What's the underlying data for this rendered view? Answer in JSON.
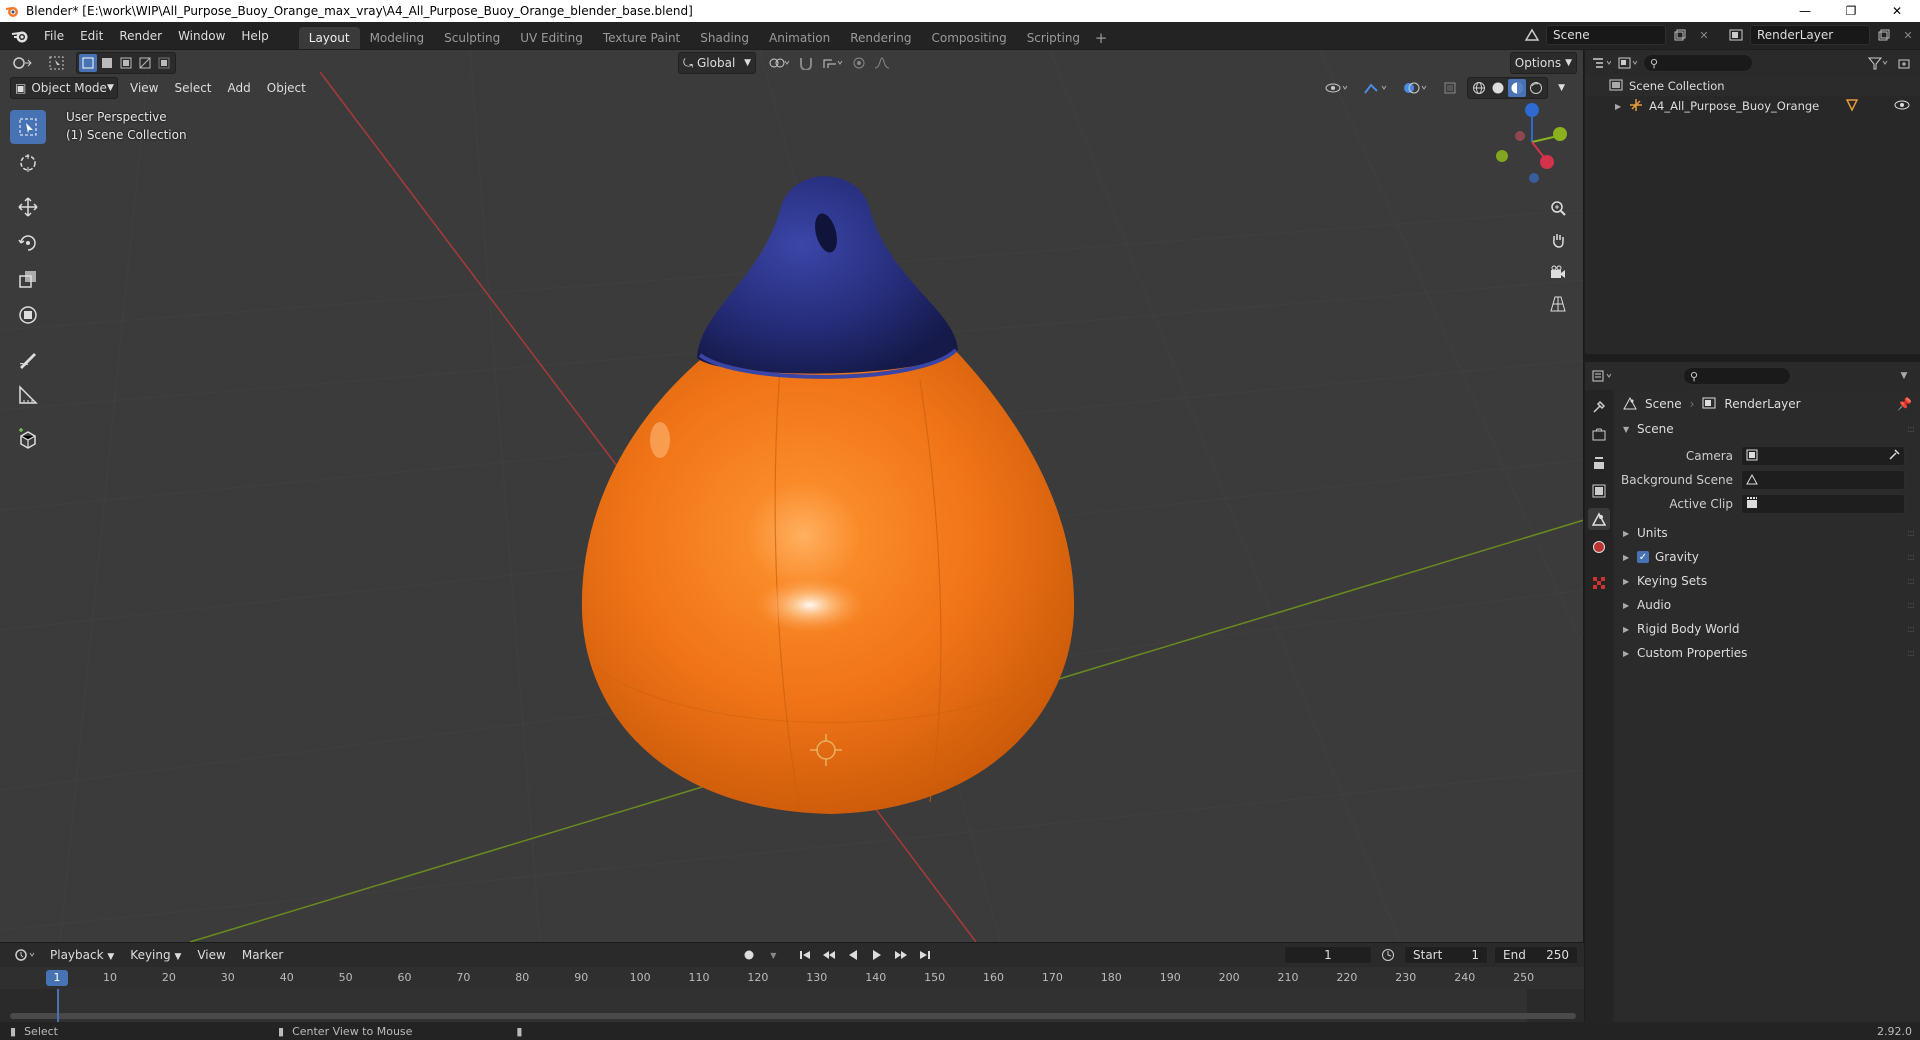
{
  "window": {
    "title": "Blender* [E:\\work\\WIP\\All_Purpose_Buoy_Orange_max_vray\\A4_All_Purpose_Buoy_Orange_blender_base.blend]"
  },
  "menu": {
    "items": [
      "File",
      "Edit",
      "Render",
      "Window",
      "Help"
    ]
  },
  "workspaces": {
    "tabs": [
      "Layout",
      "Modeling",
      "Sculpting",
      "UV Editing",
      "Texture Paint",
      "Shading",
      "Animation",
      "Rendering",
      "Compositing",
      "Scripting"
    ],
    "active": "Layout"
  },
  "topright": {
    "scene": "Scene",
    "view_layer": "RenderLayer"
  },
  "viewport": {
    "mode": "Object Mode",
    "menus": [
      "View",
      "Select",
      "Add",
      "Object"
    ],
    "transform_orientation": "Global",
    "options_label": "Options",
    "overlay_line1": "User Perspective",
    "overlay_line2": "(1) Scene Collection",
    "gizmo_axes": [
      "X",
      "Y",
      "Z"
    ],
    "colors": {
      "buoy_body": "#f07417",
      "buoy_cap": "#252c78",
      "bg": "#3b3b3b",
      "x_axis": "#a83a3a",
      "y_axis": "#6a8b1e"
    }
  },
  "outliner": {
    "root": "Scene Collection",
    "items": [
      "A4_All_Purpose_Buoy_Orange"
    ]
  },
  "properties": {
    "breadcrumb": [
      "Scene",
      "RenderLayer"
    ],
    "panel_title": "Scene",
    "fields": [
      {
        "label": "Camera"
      },
      {
        "label": "Background Scene"
      },
      {
        "label": "Active Clip"
      }
    ],
    "subpanels": [
      {
        "label": "Units",
        "checkbox": false
      },
      {
        "label": "Gravity",
        "checkbox": true
      },
      {
        "label": "Keying Sets",
        "checkbox": false
      },
      {
        "label": "Audio",
        "checkbox": false
      },
      {
        "label": "Rigid Body World",
        "checkbox": false
      },
      {
        "label": "Custom Properties",
        "checkbox": false
      }
    ]
  },
  "timeline": {
    "menus": [
      "Playback",
      "Keying",
      "View",
      "Marker"
    ],
    "current_frame": "1",
    "start_label": "Start",
    "start": "1",
    "end_label": "End",
    "end": "250",
    "ticks": [
      "10",
      "20",
      "30",
      "40",
      "50",
      "60",
      "70",
      "80",
      "90",
      "100",
      "110",
      "120",
      "130",
      "140",
      "150",
      "160",
      "170",
      "180",
      "190",
      "200",
      "210",
      "220",
      "230",
      "240",
      "250"
    ]
  },
  "status": {
    "left": "Select",
    "middle": "Center View to Mouse",
    "version": "2.92.0"
  }
}
